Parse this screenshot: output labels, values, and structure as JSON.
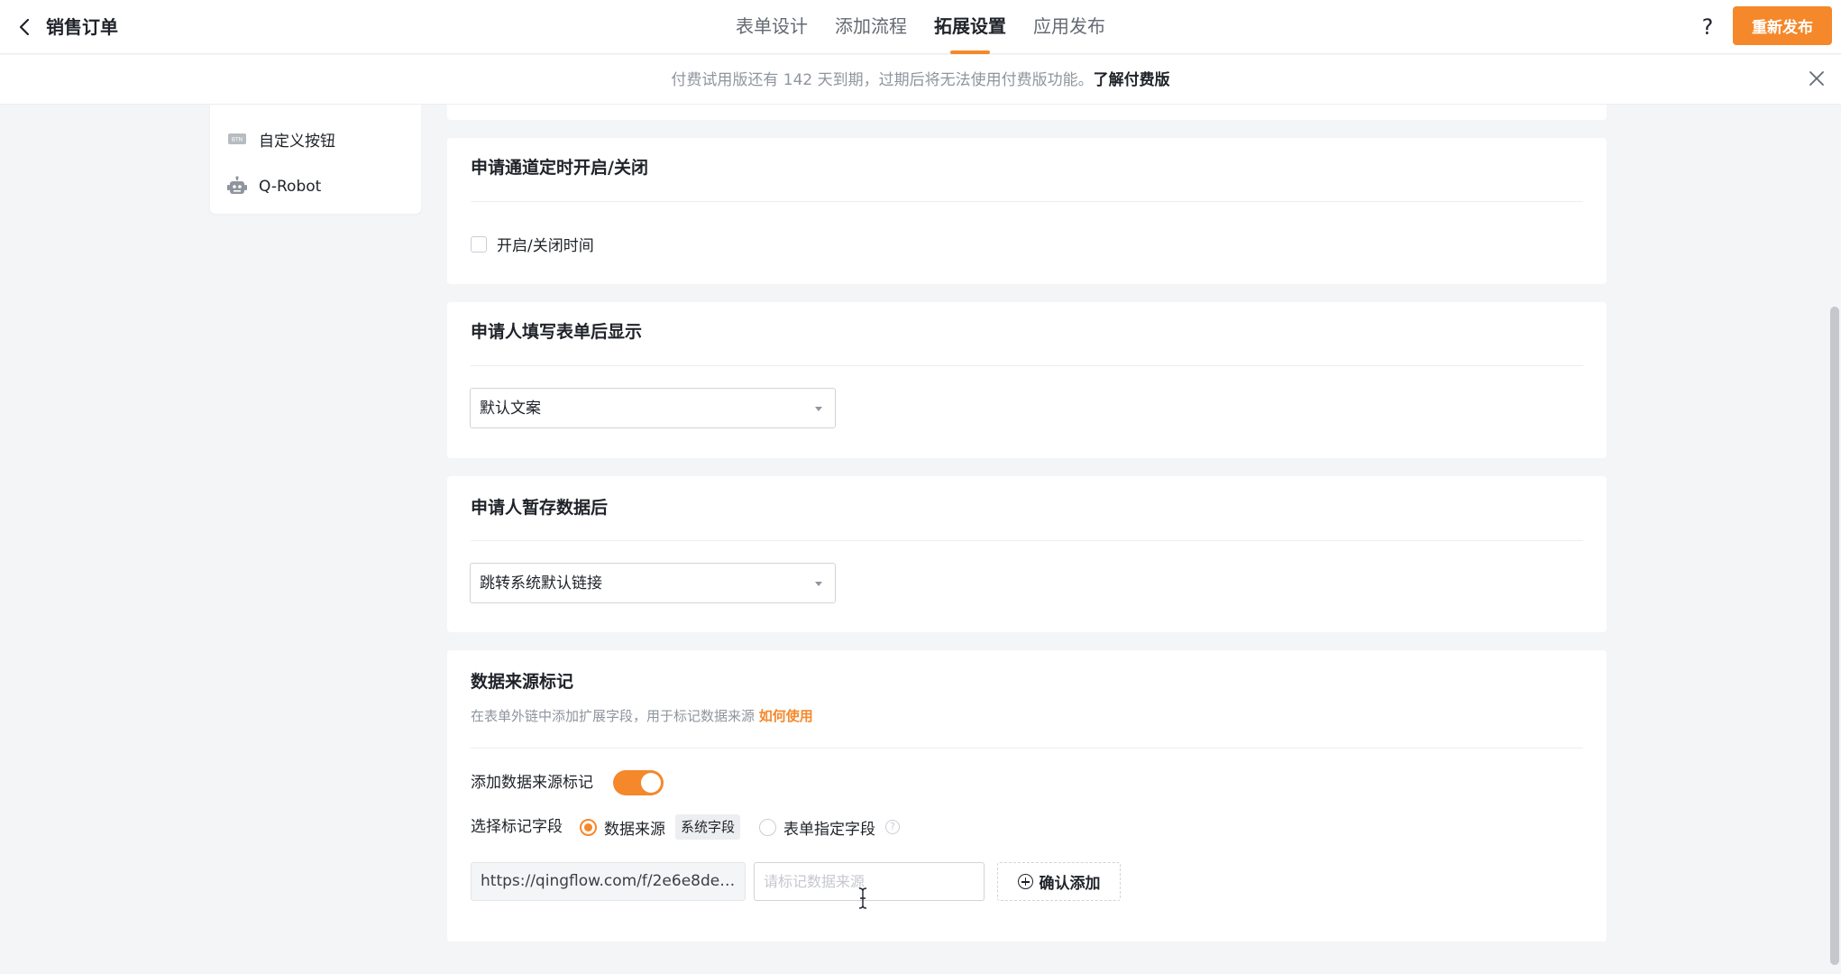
{
  "header": {
    "title": "销售订单",
    "tabs": [
      {
        "label": "表单设计"
      },
      {
        "label": "添加流程"
      },
      {
        "label": "拓展设置"
      },
      {
        "label": "应用发布"
      }
    ],
    "active_tab": "拓展设置",
    "help": "?",
    "republish_label": "重新发布"
  },
  "notice": {
    "text": "付费试用版还有 142 天到期，过期后将无法使用付费版功能。",
    "link": "了解付费版"
  },
  "side_menu": {
    "items": [
      {
        "label": "自定义按钮",
        "icon": "btn-icon"
      },
      {
        "label": "Q-Robot",
        "icon": "robot-icon"
      }
    ]
  },
  "schedule_card": {
    "title": "申请通道定时开启/关闭",
    "checkbox_label": "开启/关闭时间"
  },
  "after_submit_card": {
    "title": "申请人填写表单后显示",
    "select_value": "默认文案"
  },
  "after_draft_card": {
    "title": "申请人暂存数据后",
    "select_value": "跳转系统默认链接"
  },
  "data_source_card": {
    "title": "数据来源标记",
    "desc": "在表单外链中添加扩展字段，用于标记数据来源",
    "desc_link": "如何使用",
    "toggle_label": "添加数据来源标记",
    "toggle_on": true,
    "select_field_label": "选择标记字段",
    "radio_source": "数据来源",
    "system_tag": "系统字段",
    "radio_form_field": "表单指定字段",
    "url": "https://qingflow.com/f/2e6e8de2?...",
    "mark_placeholder": "请标记数据来源",
    "confirm_label": "确认添加"
  },
  "colors": {
    "accent": "#f5882b",
    "background": "#f4f5f7"
  }
}
